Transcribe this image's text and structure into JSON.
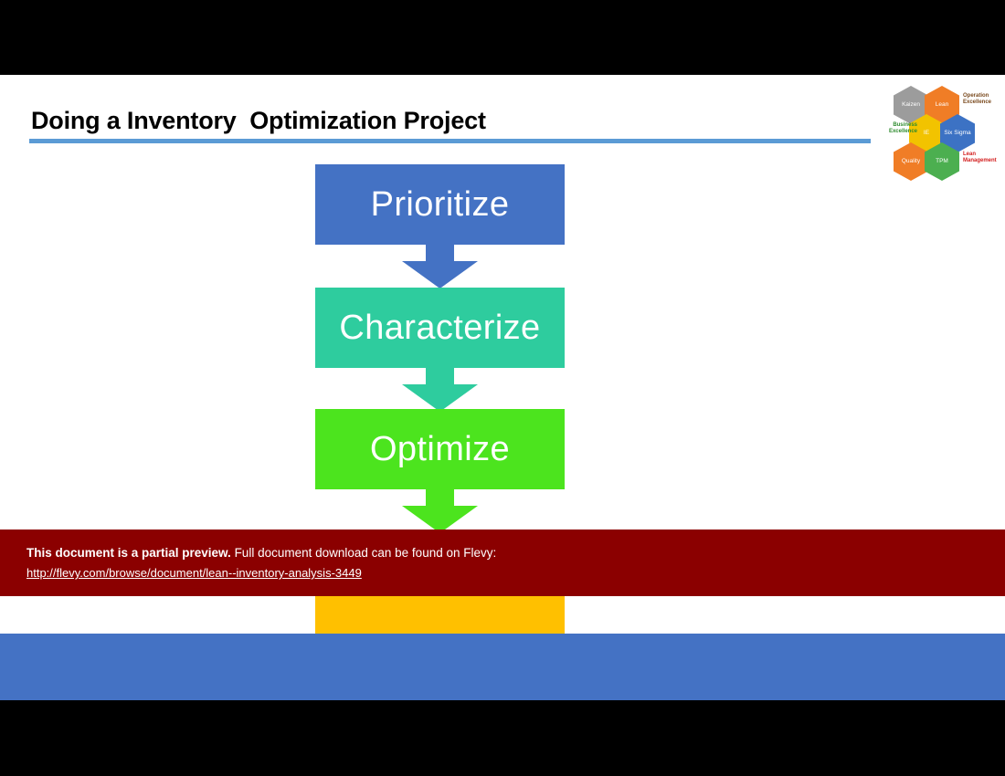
{
  "slide": {
    "title": "Doing a Inventory  Optimization Project",
    "accent_rule_color": "#5B9BD5"
  },
  "logo": {
    "hexagons": [
      {
        "id": "kaizen",
        "label": "Kaizen",
        "color": "#9C9C9C"
      },
      {
        "id": "lean",
        "label": "Lean",
        "color": "#F07D26"
      },
      {
        "id": "center",
        "label": "IE",
        "color": "#F2C300"
      },
      {
        "id": "six",
        "label": "Six\nSigma",
        "color": "#3C72C4"
      },
      {
        "id": "quality",
        "label": "Quality",
        "color": "#F07D26"
      },
      {
        "id": "tpm",
        "label": "TPM",
        "color": "#4CAF50"
      }
    ],
    "side_labels": [
      {
        "id": "operation-excellence",
        "text": "Operation\nExcellence",
        "color": "#7A4A1E"
      },
      {
        "id": "business-excellence",
        "text": "Business\nExcellence",
        "color": "#2E8B2E"
      },
      {
        "id": "lean-management",
        "text": "Lean\nManagement",
        "color": "#D32020"
      }
    ]
  },
  "flow": {
    "steps": [
      {
        "id": "prioritize",
        "label": "Prioritize",
        "color": "#4472C4"
      },
      {
        "id": "characterize",
        "label": "Characterize",
        "color": "#2ECC9E"
      },
      {
        "id": "optimize",
        "label": "Optimize",
        "color": "#4CE41E"
      },
      {
        "id": "final",
        "label": "",
        "color": "#FFC000"
      }
    ]
  },
  "banner": {
    "strong_text": "This document is a partial preview.",
    "rest_text": " Full document download can be found on Flevy:",
    "url": "http://flevy.com/browse/document/lean--inventory-analysis-3449",
    "background": "#8B0000"
  },
  "footer": {
    "bar_color": "#4472C4"
  }
}
